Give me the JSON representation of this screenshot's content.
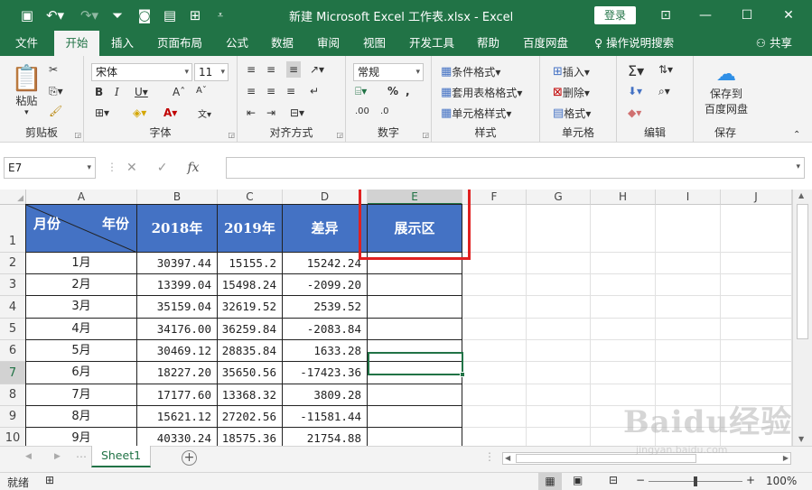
{
  "titlebar": {
    "title": "新建 Microsoft Excel 工作表.xlsx  -  Excel",
    "login_label": "登录",
    "accent": "#217346"
  },
  "tabs": [
    "文件",
    "开始",
    "插入",
    "页面布局",
    "公式",
    "数据",
    "审阅",
    "视图",
    "开发工具",
    "帮助",
    "百度网盘"
  ],
  "active_tab": "开始",
  "tell_me": "操作说明搜索",
  "share": "共享",
  "ribbon": {
    "clipboard": {
      "paste": "粘贴",
      "label": "剪贴板"
    },
    "font": {
      "name": "宋体",
      "size": "11",
      "label": "字体"
    },
    "alignment": {
      "label": "对齐方式"
    },
    "number": {
      "format": "常规",
      "label": "数字"
    },
    "styles": {
      "conditional": "条件格式",
      "table": "套用表格格式",
      "cell": "单元格样式",
      "label": "样式"
    },
    "cells": {
      "insert": "插入",
      "delete": "删除",
      "format": "格式",
      "label": "单元格"
    },
    "editing": {
      "label": "编辑"
    },
    "save": {
      "line1": "保存到",
      "line2": "百度网盘",
      "label": "保存"
    }
  },
  "formula_bar": {
    "name_box": "E7",
    "fx": "fx",
    "value": ""
  },
  "columns": [
    "A",
    "B",
    "C",
    "D",
    "E",
    "F",
    "G",
    "H",
    "I",
    "J"
  ],
  "selected_column": "E",
  "rows": [
    "1",
    "2",
    "3",
    "4",
    "5",
    "6",
    "7",
    "8",
    "9",
    "10"
  ],
  "selected_row": "7",
  "table": {
    "header_corner_left": "月份",
    "header_corner_right": "年份",
    "headers": [
      "2018年",
      "2019年",
      "差异",
      "展示区"
    ],
    "header_color": "#4472c4",
    "data": [
      [
        "1月",
        "30397.44",
        "15155.2",
        "15242.24"
      ],
      [
        "2月",
        "13399.04",
        "15498.24",
        "-2099.20"
      ],
      [
        "3月",
        "35159.04",
        "32619.52",
        "2539.52"
      ],
      [
        "4月",
        "34176.00",
        "36259.84",
        "-2083.84"
      ],
      [
        "5月",
        "30469.12",
        "28835.84",
        "1633.28"
      ],
      [
        "6月",
        "18227.20",
        "35650.56",
        "-17423.36"
      ],
      [
        "7月",
        "17177.60",
        "13368.32",
        "3809.28"
      ],
      [
        "8月",
        "15621.12",
        "27202.56",
        "-11581.44"
      ],
      [
        "9月",
        "40330.24",
        "18575.36",
        "21754.88"
      ]
    ]
  },
  "highlight_color": "#e02020",
  "sheet_tab": "Sheet1",
  "status": {
    "ready": "就绪",
    "zoom": "100%"
  },
  "watermark": {
    "main": "Baidu经验",
    "sub": "jingyan.baidu.com"
  }
}
